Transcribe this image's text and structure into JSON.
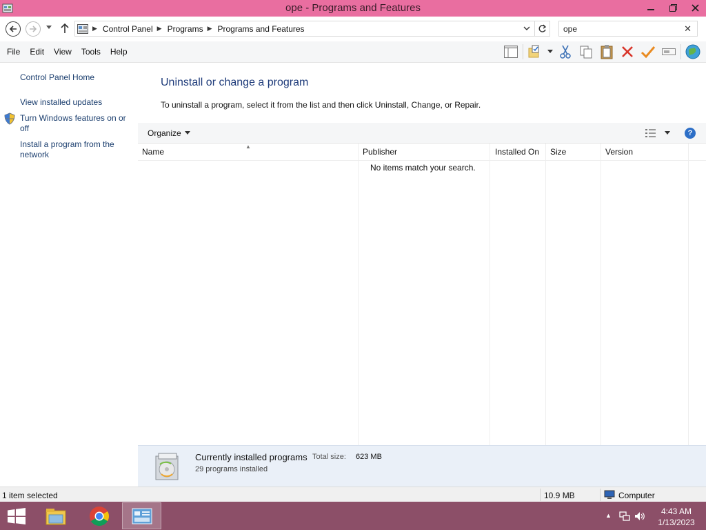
{
  "window": {
    "title": "ope - Programs and Features",
    "buttons": [
      "minimize",
      "restore",
      "close"
    ]
  },
  "address": {
    "breadcrumbs": [
      "Control Panel",
      "Programs",
      "Programs and Features"
    ],
    "search_value": "ope"
  },
  "menu": {
    "items": [
      "File",
      "Edit",
      "View",
      "Tools",
      "Help"
    ]
  },
  "toolbar": {
    "icons": [
      "layout-pane-icon",
      "properties-folder-icon",
      "cut-icon",
      "copy-icon",
      "paste-icon",
      "delete-icon",
      "check-icon",
      "rename-icon",
      "globe-icon"
    ]
  },
  "sidebar": {
    "items": [
      {
        "label": "Control Panel Home"
      },
      {
        "label": "View installed updates"
      },
      {
        "label": "Turn Windows features on or off"
      },
      {
        "label": "Install a program from the network"
      }
    ]
  },
  "main": {
    "heading": "Uninstall or change a program",
    "subtext": "To uninstall a program, select it from the list and then click Uninstall, Change, or Repair.",
    "organize_label": "Organize",
    "columns": [
      "Name",
      "Publisher",
      "Installed On",
      "Size",
      "Version"
    ],
    "empty_message": "No items match your search."
  },
  "details": {
    "title": "Currently installed programs",
    "total_size_label": "Total size:",
    "total_size_value": "623 MB",
    "count": "29 programs installed"
  },
  "status": {
    "selection": "1 item selected",
    "size": "10.9 MB",
    "location": "Computer"
  },
  "taskbar": {
    "apps": [
      "file-explorer-icon",
      "chrome-icon",
      "control-panel-icon"
    ],
    "time": "4:43 AM",
    "date": "1/13/2023"
  },
  "colors": {
    "titlebar": "#e96ea0",
    "taskbar": "#8c4f68",
    "link": "#1b3e6e",
    "heading": "#1e3b7a"
  }
}
